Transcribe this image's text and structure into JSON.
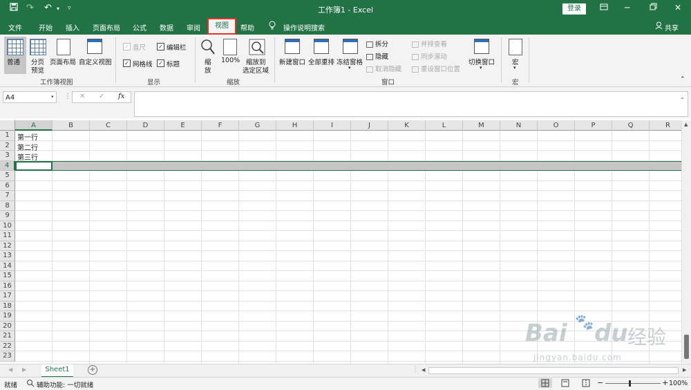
{
  "titlebar": {
    "title": "工作簿1  -  Excel",
    "login": "登录",
    "icons": [
      "save-icon",
      "undo-icon",
      "redo-icon",
      "customize-qat-icon",
      "ribbon-display-icon",
      "minimize-icon",
      "restore-icon",
      "close-icon"
    ]
  },
  "tabs": {
    "file": "文件",
    "home": "开始",
    "insert": "插入",
    "layout": "页面布局",
    "formulas": "公式",
    "data": "数据",
    "review": "审阅",
    "view": "视图",
    "help": "帮助",
    "tell": "操作说明搜索",
    "share": "共享"
  },
  "ribbon": {
    "workbook_views": {
      "group": "工作簿视图",
      "normal": "普通",
      "page_break_1": "分页",
      "page_break_2": "预览",
      "page_layout": "页面布局",
      "custom": "自定义视图"
    },
    "show": {
      "group": "显示",
      "ruler": "直尺",
      "formula_bar": "编辑栏",
      "gridlines": "网格线",
      "headings": "标题"
    },
    "zoom": {
      "group": "缩放",
      "zoom_1": "缩",
      "zoom_2": "放",
      "hundred": "100%",
      "to_selection_1": "缩放到",
      "to_selection_2": "选定区域"
    },
    "window": {
      "group": "窗口",
      "new_window": "新建窗口",
      "arrange_all": "全部重排",
      "freeze": "冻结窗格",
      "split": "拆分",
      "hide": "隐藏",
      "unhide": "取消隐藏",
      "side_by_side": "并排查看",
      "sync_scroll": "同步滚动",
      "reset_pos": "重设窗口位置",
      "switch": "切换窗口"
    },
    "macros": {
      "group": "宏",
      "macros": "宏"
    }
  },
  "formula": {
    "namebox": "A4",
    "cancel": "✕",
    "enter": "✓",
    "fx": "fx",
    "value": ""
  },
  "grid": {
    "columns": [
      "A",
      "B",
      "C",
      "D",
      "E",
      "F",
      "G",
      "H",
      "I",
      "J",
      "K",
      "L",
      "M",
      "N",
      "O",
      "P",
      "Q",
      "R"
    ],
    "rows": [
      "1",
      "2",
      "3",
      "4",
      "5",
      "6",
      "7",
      "8",
      "9",
      "10",
      "11",
      "12",
      "13",
      "14",
      "15",
      "16",
      "17",
      "18",
      "19",
      "20",
      "21",
      "22",
      "23"
    ],
    "cells": {
      "A1": "第一行",
      "A2": "第二行",
      "A3": "第三行"
    }
  },
  "sheets": {
    "active": "Sheet1",
    "add": "+"
  },
  "status": {
    "ready": "就绪",
    "accessibility": "辅助功能: 一切就绪",
    "zoom": "100%",
    "zoom_minus": "−",
    "zoom_plus": "+"
  },
  "watermark": {
    "brand": "Bai",
    "brand2": "du",
    "cn": "经验",
    "url": "jingyan.baidu.com"
  },
  "colors": {
    "accent": "#217346",
    "highlight": "#e0312b"
  }
}
